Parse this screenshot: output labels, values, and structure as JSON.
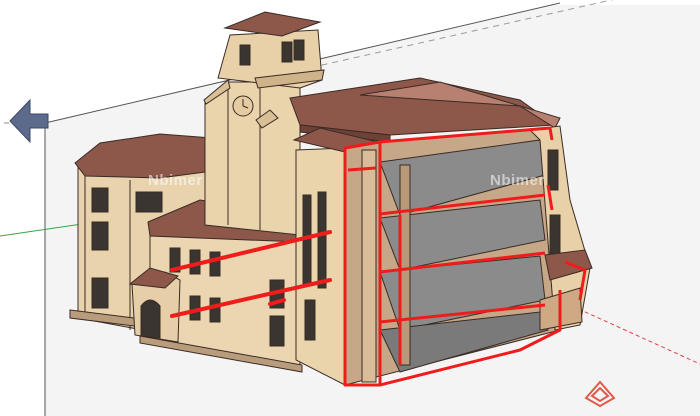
{
  "viewport": {
    "background": "#ffffff",
    "section_plane_color": "#ef1c1c",
    "wall_color": "#ecd8b6",
    "roof_color": "#8e5a4d",
    "floor_color": "#8b8b8b"
  },
  "watermarks": [
    "Nbimer",
    "Nbimer"
  ],
  "axes": {
    "green": "#3ba344",
    "red": "#d64545",
    "blue": "#4a57c9"
  },
  "icons": [
    "section-plane-arrow-icon",
    "site-logo-icon"
  ]
}
